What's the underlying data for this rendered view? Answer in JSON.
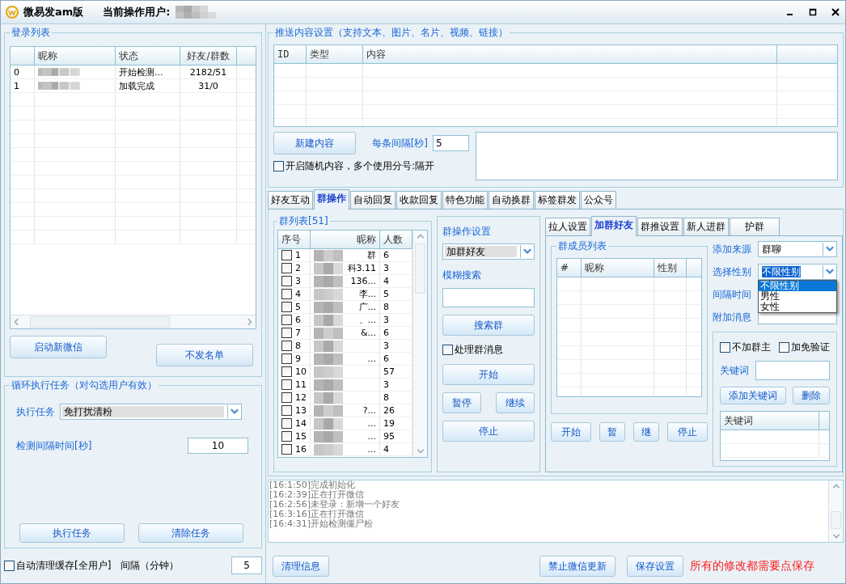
{
  "window": {
    "title": "微易发am版",
    "user_label": "当前操作用户:"
  },
  "login_list": {
    "title": "登录列表",
    "columns": [
      "昵称",
      "状态",
      "好友/群数"
    ],
    "rows": [
      {
        "index": "0",
        "status": "开始检测...",
        "counts": "2182/51"
      },
      {
        "index": "1",
        "status": "加载完成",
        "counts": "31/0"
      }
    ],
    "buttons": [
      "启动新微信",
      "不发名单"
    ]
  },
  "loop_task": {
    "title": "循环执行任务（对勾选用户有效）",
    "task_label": "执行任务",
    "task_value": "免打扰清粉",
    "interval_label": "检测间隔时间[秒]",
    "interval_value": "10",
    "buttons": [
      "执行任务",
      "清除任务"
    ]
  },
  "auto_clean": {
    "label": "自动清理缓存[全用户]",
    "checked": false,
    "interval_label": "间隔（分钟）",
    "interval_value": "5"
  },
  "push": {
    "title": "推送内容设置（支持文本、图片、名片、视频、链接）",
    "columns": [
      "ID",
      "类型",
      "内容"
    ],
    "new_button": "新建内容",
    "interval_label": "每条间隔[秒]",
    "interval_value": "5",
    "random": {
      "label": "开启随机内容，多个使用分号:隔开",
      "checked": false
    }
  },
  "tabs": [
    {
      "label": "好友互动",
      "selected": false
    },
    {
      "label": "群操作",
      "selected": true
    },
    {
      "label": "自动回复",
      "selected": false
    },
    {
      "label": "收款回复",
      "selected": false
    },
    {
      "label": "特色功能",
      "selected": false
    },
    {
      "label": "自动换群",
      "selected": false
    },
    {
      "label": "标签群发",
      "selected": false
    },
    {
      "label": "公众号",
      "selected": false
    }
  ],
  "group_list": {
    "title": "群列表[51]",
    "columns": [
      "序号",
      "昵称",
      "人数"
    ],
    "rows": [
      {
        "no": "1",
        "name": "群",
        "count": "6",
        "checked": false
      },
      {
        "no": "2",
        "name": "科3.11",
        "count": "3",
        "checked": false
      },
      {
        "no": "3",
        "name": "136...",
        "count": "4",
        "checked": false
      },
      {
        "no": "4",
        "name": "李...",
        "count": "5",
        "checked": false
      },
      {
        "no": "5",
        "name": "广...",
        "count": "8",
        "checked": false
      },
      {
        "no": "6",
        "name": "、...",
        "count": "3",
        "checked": false
      },
      {
        "no": "7",
        "name": "&...",
        "count": "6",
        "checked": false
      },
      {
        "no": "8",
        "count": "3",
        "checked": false
      },
      {
        "no": "9",
        "name": "...",
        "count": "6",
        "checked": false
      },
      {
        "no": "10",
        "count": "57",
        "checked": false
      },
      {
        "no": "11",
        "count": "3",
        "checked": false
      },
      {
        "no": "12",
        "count": "8",
        "checked": false
      },
      {
        "no": "13",
        "name": "?...",
        "count": "26",
        "checked": false
      },
      {
        "no": "14",
        "name": "...",
        "count": "19",
        "checked": false
      },
      {
        "no": "15",
        "name": "...",
        "count": "95",
        "checked": false
      },
      {
        "no": "16",
        "name": "...",
        "count": "4",
        "checked": false
      }
    ]
  },
  "group_ops": {
    "title": "群操作设置",
    "mode": "加群好友",
    "search_label": "模糊搜索",
    "search_button": "搜索群",
    "process": {
      "label": "处理群消息",
      "checked": false
    },
    "buttons": [
      "开始",
      "暂停",
      "继续",
      "停止"
    ]
  },
  "sub_tabs": [
    {
      "label": "拉人设置",
      "selected": false
    },
    {
      "label": "加群好友",
      "selected": true
    },
    {
      "label": "群推设置",
      "selected": false
    },
    {
      "label": "新人进群",
      "selected": false
    },
    {
      "label": "护群",
      "selected": false
    }
  ],
  "members": {
    "title": "群成员列表",
    "columns": [
      "#",
      "昵称",
      "性别"
    ],
    "buttons": [
      "开始",
      "暂",
      "继",
      "停止"
    ]
  },
  "add_settings": {
    "source_label": "添加来源",
    "source_value": "群聊",
    "gender_label": "选择性别",
    "gender_value": "不限性别",
    "gender_options": [
      {
        "label": "不限性别",
        "selected": true
      },
      {
        "label": "男性",
        "selected": false
      },
      {
        "label": "女性",
        "selected": false
      }
    ],
    "interval_label": "间隔时间",
    "message_label": "附加消息",
    "checks": [
      {
        "label": "不加群主",
        "checked": false
      },
      {
        "label": "加免验证",
        "checked": false
      }
    ],
    "keyword_label": "关键词",
    "keyword_buttons": [
      "添加关键词",
      "删除"
    ],
    "keyword_column": "关键词"
  },
  "log": [
    "[16:1:50]完成初始化",
    "[16:2:39]正在打开微信",
    "[16:2:56]未登录：新增一个好友",
    "[16:3:16]正在打开微信",
    "[16:4:31]开始检测僵尸粉"
  ],
  "footer": {
    "buttons": [
      "清理信息",
      "禁止微信更新",
      "保存设置"
    ],
    "notice": "所有的修改都需要点保存"
  }
}
